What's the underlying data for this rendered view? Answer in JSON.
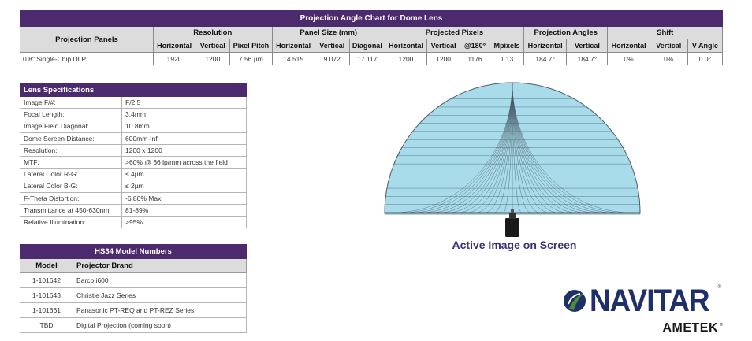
{
  "projection_chart": {
    "title": "Projection Angle Chart for Dome Lens",
    "panels_header": "Projection Panels",
    "groups": [
      "Resolution",
      "Panel Size (mm)",
      "Projected Pixels",
      "Projection Angles",
      "Shift"
    ],
    "subheaders": [
      "Horizontal",
      "Vertical",
      "Pixel Pitch",
      "Horizontal",
      "Vertical",
      "Diagonal",
      "Horizontal",
      "Vertical",
      "@180°",
      "Mpixels",
      "Horizontal",
      "Vertical",
      "Horizontal",
      "Vertical",
      "V Angle"
    ],
    "row": [
      "0.8\" Single-Chip DLP",
      "1920",
      "1200",
      "7.56 µm",
      "14.515",
      "9.072",
      "17.117",
      "1200",
      "1200",
      "1176",
      "1.13",
      "184.7°",
      "184.7°",
      "0%",
      "0%",
      "0.0°"
    ]
  },
  "lens_specs": {
    "title": "Lens Specifications",
    "rows": [
      {
        "label": "Image F/#:",
        "value": "F/2.5"
      },
      {
        "label": "Focal Length:",
        "value": "3.4mm"
      },
      {
        "label": "Image Field Diagonal:",
        "value": "10.8mm"
      },
      {
        "label": "Dome Screen Distance:",
        "value": "600mm-Inf"
      },
      {
        "label": "Resolution:",
        "value": "1200 x 1200"
      },
      {
        "label": "MTF:",
        "value": ">60% @ 66 lp/mm across the field"
      },
      {
        "label": "Lateral Color R-G:",
        "value": "≤ 4µm"
      },
      {
        "label": "Lateral Color B-G:",
        "value": "≤ 2µm"
      },
      {
        "label": "F-Theta Distortion:",
        "value": "-6.80% Max"
      },
      {
        "label": "Transmittance at 450-630nm:",
        "value": "81-89%"
      },
      {
        "label": "Relative Illumination:",
        "value": ">95%"
      }
    ]
  },
  "models": {
    "title": "HS34 Model Numbers",
    "headers": [
      "Model",
      "Projector Brand"
    ],
    "rows": [
      {
        "model": "1-101642",
        "brand": "Barco i600"
      },
      {
        "model": "1-101643",
        "brand": "Christie Jazz Series"
      },
      {
        "model": "1-101661",
        "brand": "Panasonic PT-REQ and PT-REZ Series"
      },
      {
        "model": "TBD",
        "brand": "Digital Projection (coming soon)"
      }
    ]
  },
  "dome": {
    "caption": "Active Image on Screen",
    "fill_color": "#a9dcea",
    "line_color": "#4a5a6a"
  },
  "logo": {
    "brand": "NAVITAR",
    "parent": "AMETEK",
    "reg": "®",
    "brand_color": "#1f2f6a",
    "accent_color": "#4a8c3a"
  },
  "colors": {
    "header_purple": "#4b2a6e",
    "header_gray": "#dcdcdc",
    "caption_blue": "#3d3077"
  }
}
